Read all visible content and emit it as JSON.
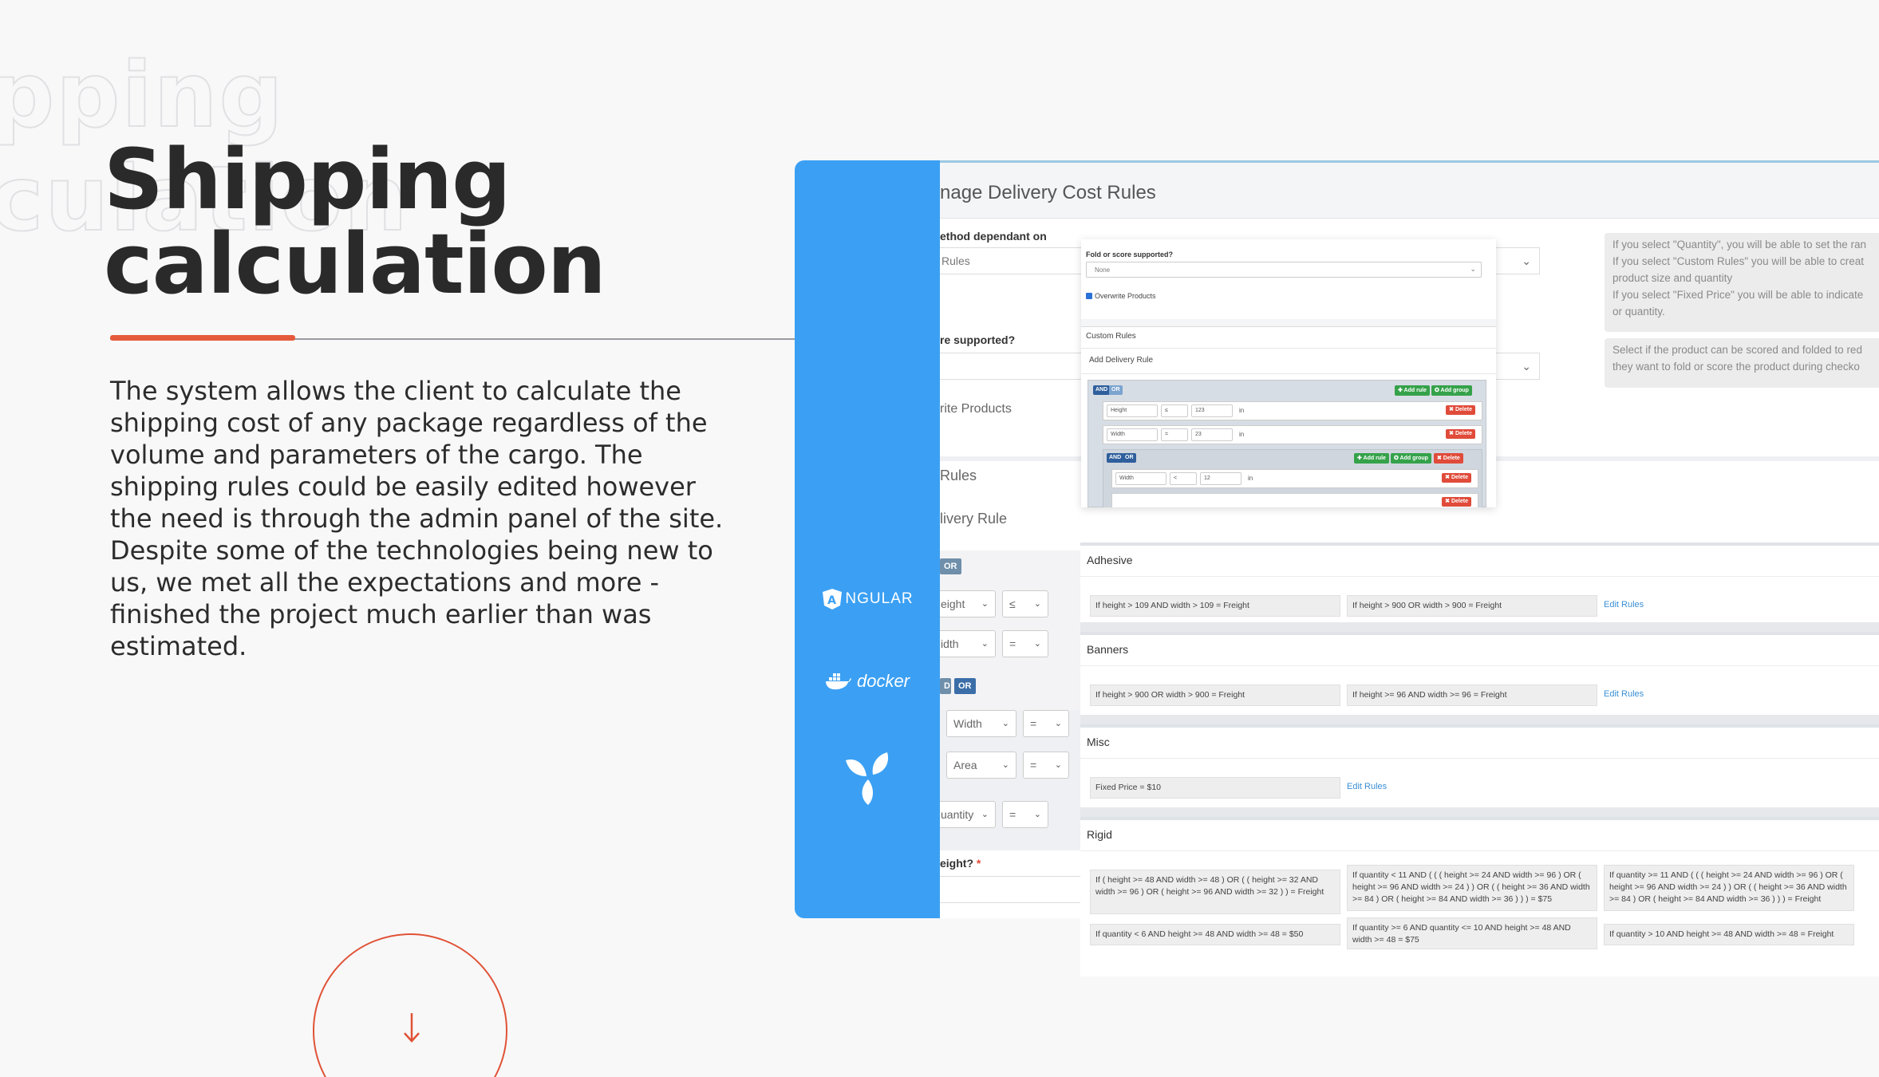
{
  "hero": {
    "ghost_line1": "pping",
    "ghost_line2": "culation",
    "title_line1": "Shipping",
    "title_line2": "calculation",
    "description": "The system allows the client to calculate the shipping cost of any package regardless of the volume and parameters of the cargo. The shipping rules could be easily edited however the need is through the admin panel of the site. Despite some of the technologies being new to us, we met all the expectations and more - finished the project much earlier than was estimated.",
    "accent_color": "#e55a3c"
  },
  "tech_stack": {
    "angular": "NGULAR",
    "angular_mark": "A",
    "docker": "docker",
    "leaf_icon": "leaf-logo-icon",
    "bar_color": "#3ba0f3"
  },
  "admin": {
    "page_title": "nage Delivery Cost Rules",
    "method_label": "ethod dependant on",
    "method_value": "Rules",
    "fold_label": "re supported?",
    "overwrite_label": "rite Products",
    "rules_header": "Rules",
    "delivery_rule_header": "livery Rule",
    "help_method": [
      "If you select \"Quantity\", you will be able to set the ran",
      "If you select \"Custom Rules\" you will be able to creat",
      "product size and quantity",
      "If you select \"Fixed Price\" you will be able to indicate",
      "or quantity."
    ],
    "help_fold": [
      "Select if the product can be scored and folded to red",
      "they want to fold or score the product during checko"
    ],
    "or_chip": "OR",
    "and_chip": "D",
    "or_chip2": "OR",
    "rows": [
      {
        "field": "eight",
        "op": "≤"
      },
      {
        "field": "idth",
        "op": "="
      },
      {
        "field": "Width",
        "op": "="
      },
      {
        "field": "Area",
        "op": "="
      },
      {
        "field": "uantity",
        "op": "="
      }
    ],
    "weight_label": "eight?",
    "required_mark": "*"
  },
  "popup": {
    "fold_label": "Fold or score supported?",
    "fold_value": "None",
    "overwrite_checkbox": "Overwrite Products",
    "custom_rules": "Custom Rules",
    "add_rule": "Add Delivery Rule",
    "and": "AND",
    "or": "OR",
    "add_rule_btn": "✚ Add rule",
    "add_group_btn": "✪ Add group",
    "delete_btn": "✖ Delete",
    "rule1": {
      "field": "Height",
      "op": "≤",
      "value": "123",
      "unit": "in"
    },
    "rule2": {
      "field": "Width",
      "op": "=",
      "value": "23",
      "unit": "in"
    },
    "rule3": {
      "field": "Width",
      "op": "<",
      "value": "12",
      "unit": "in"
    }
  },
  "cards": [
    {
      "title": "Adhesive",
      "rules": [
        "If height > 109 AND width > 109 = Freight",
        "If height > 900 OR width > 900 = Freight"
      ],
      "edit": "Edit Rules"
    },
    {
      "title": "Banners",
      "rules": [
        "If height > 900 OR width > 900 = Freight",
        "If height >= 96 AND width >= 96 = Freight"
      ],
      "edit": "Edit Rules"
    },
    {
      "title": "Misc",
      "rules": [
        "Fixed Price = $10"
      ],
      "edit": "Edit Rules"
    },
    {
      "title": "Rigid",
      "rules": [
        "If ( height >= 48 AND width >= 48 ) OR ( ( height >= 32 AND width >= 96 ) OR ( height >= 96 AND width >= 32 ) ) = Freight",
        "If quantity < 11 AND ( ( ( height >= 24 AND width >= 96 ) OR ( height >= 96 AND width >= 24 ) ) OR ( ( height >= 36 AND width >= 84 ) OR ( height >= 84 AND width >= 36 ) ) ) = $75",
        "If quantity >= 11 AND ( ( ( height >= 24 AND width >= 96 ) OR ( height >= 96 AND width >= 24 ) ) OR ( ( height >= 36 AND width >= 84 ) OR ( height >= 84 AND width >= 36 ) ) ) = Freight",
        "If quantity < 6 AND height >= 48 AND width >= 48 = $50",
        "If quantity >= 6 AND quantity <= 10 AND height >= 48 AND width >= 48 = $75",
        "If quantity > 10 AND height >= 48 AND width >= 48 = Freight"
      ]
    }
  ]
}
